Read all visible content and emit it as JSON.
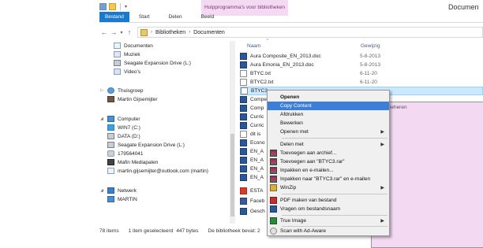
{
  "window": {
    "title": "Documen",
    "context_tab_title": "Hulpprogramma's voor bibliotheken"
  },
  "ribbon": {
    "tabs": [
      "Bestand",
      "Start",
      "Delen",
      "Beeld"
    ],
    "context_tab": "Beheren"
  },
  "address": {
    "crumbs": [
      "Bibliotheken",
      "Documenten"
    ]
  },
  "sidebar": {
    "items": [
      {
        "label": "Documenten",
        "icon": "documents-icon"
      },
      {
        "label": "Muziek",
        "icon": "music-icon"
      },
      {
        "label": "Seagate Expansion Drive (L:)",
        "icon": "drive-icon"
      },
      {
        "label": "Video's",
        "icon": "video-icon"
      },
      {
        "label": "Thuisgroep",
        "icon": "homegroup-icon"
      },
      {
        "label": "Martin Gijsemijter",
        "icon": "user-icon"
      },
      {
        "label": "Computer",
        "icon": "computer-icon"
      },
      {
        "label": "WIN7 (C:)",
        "icon": "windows-drive-icon"
      },
      {
        "label": "DATA (D:)",
        "icon": "drive-icon"
      },
      {
        "label": "Seagate Expansion Drive (L:)",
        "icon": "drive-icon"
      },
      {
        "label": "179564041",
        "icon": "dvd-icon"
      },
      {
        "label": "Mafin Mediapalen",
        "icon": "phone-icon"
      },
      {
        "label": "martin.gijsemijter@outlook.com (martin)",
        "icon": "cloud-icon"
      },
      {
        "label": "Netwerk",
        "icon": "network-icon"
      },
      {
        "label": "MARTIN",
        "icon": "computer-icon"
      }
    ]
  },
  "filelist": {
    "columns": {
      "name": "Naam",
      "date": "Gewijzig"
    },
    "rows": [
      {
        "name": "Aura Composite_EN_2013.doc",
        "date": "5-8-2013",
        "icon": "doc"
      },
      {
        "name": "Aura Emonia_EN_2013.doc",
        "date": "5-8-2013",
        "icon": "doc"
      },
      {
        "name": "BTYC.txt",
        "date": "6-11-20",
        "icon": "txt"
      },
      {
        "name": "BTYC2.txt",
        "date": "6-11-20",
        "icon": "txt"
      },
      {
        "name": "BTYC3",
        "date": "",
        "icon": "txt"
      },
      {
        "name": "Compe",
        "date": "",
        "icon": "doc"
      },
      {
        "name": "Comp",
        "date": "",
        "icon": "doc"
      },
      {
        "name": "Curric",
        "date": "",
        "icon": "doc"
      },
      {
        "name": "Curric",
        "date": "",
        "icon": "doc"
      },
      {
        "name": "dit is",
        "date": "",
        "icon": "txt"
      },
      {
        "name": "Econo",
        "date": "",
        "icon": "doc"
      },
      {
        "name": "EN_A",
        "date": "",
        "icon": "doc"
      },
      {
        "name": "EN_A",
        "date": "",
        "icon": "doc"
      },
      {
        "name": "EN_A",
        "date": "",
        "icon": "doc"
      },
      {
        "name": "EN_A",
        "date": "",
        "icon": "doc"
      },
      {
        "name": "ESTA",
        "date": "",
        "icon": "pdf"
      },
      {
        "name": "Faceb",
        "date": "",
        "icon": "fb"
      },
      {
        "name": "Gesch",
        "date": "",
        "icon": "doc"
      }
    ]
  },
  "context_menu": {
    "items": [
      {
        "label": "Openen",
        "bold": true
      },
      {
        "label": "Copy Content",
        "highlight": true
      },
      {
        "label": "Afdrukken"
      },
      {
        "label": "Bewerken"
      },
      {
        "label": "Openen met",
        "submenu": true
      },
      {
        "sep": true
      },
      {
        "label": "Delen met",
        "submenu": true
      },
      {
        "label": "Toevoegen aan archief...",
        "icon": "winrar-icon"
      },
      {
        "label": "Toevoegen aan \"BTYC3.rar\"",
        "icon": "winrar-icon"
      },
      {
        "label": "Inpakken en e-mailen...",
        "icon": "winrar-icon"
      },
      {
        "label": "Inpakken naar \"BTYC3.rar\" en e-mailen",
        "icon": "winrar-icon"
      },
      {
        "label": "WinZip",
        "icon": "winzip-icon",
        "submenu": true
      },
      {
        "sep": true
      },
      {
        "label": "PDF maken van bestand",
        "icon": "pdf-icon"
      },
      {
        "label": "Vragen om bestandsnaam",
        "icon": "word-icon"
      },
      {
        "sep": true
      },
      {
        "label": "True Image",
        "icon": "true-image-icon",
        "submenu": true
      },
      {
        "sep": true
      },
      {
        "label": "Scan with Ad-Aware",
        "icon": "ad-aware-icon"
      }
    ]
  },
  "statusbar": {
    "items": "78 items",
    "selected": "1 item geselecteerd",
    "size": "447 bytes",
    "library": "De bibliotheek bevat: 2"
  }
}
